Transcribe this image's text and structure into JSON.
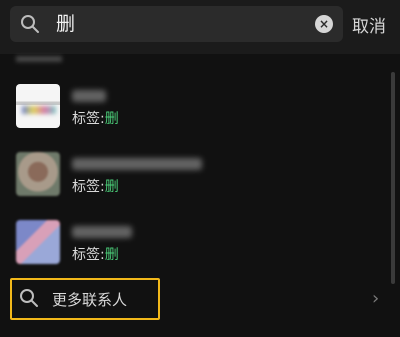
{
  "search": {
    "query": "删",
    "clear_label": "×",
    "cancel_label": "取消"
  },
  "results": [
    {
      "tag_prefix": "标签:",
      "tag_value": "删"
    },
    {
      "tag_prefix": "标签:",
      "tag_value": "删"
    },
    {
      "tag_prefix": "标签:",
      "tag_value": "删"
    }
  ],
  "more": {
    "label": "更多联系人",
    "chevron": "›"
  },
  "colors": {
    "background": "#111111",
    "tag_highlight": "#4ccf7a",
    "focus_outline": "#f2b81a"
  }
}
